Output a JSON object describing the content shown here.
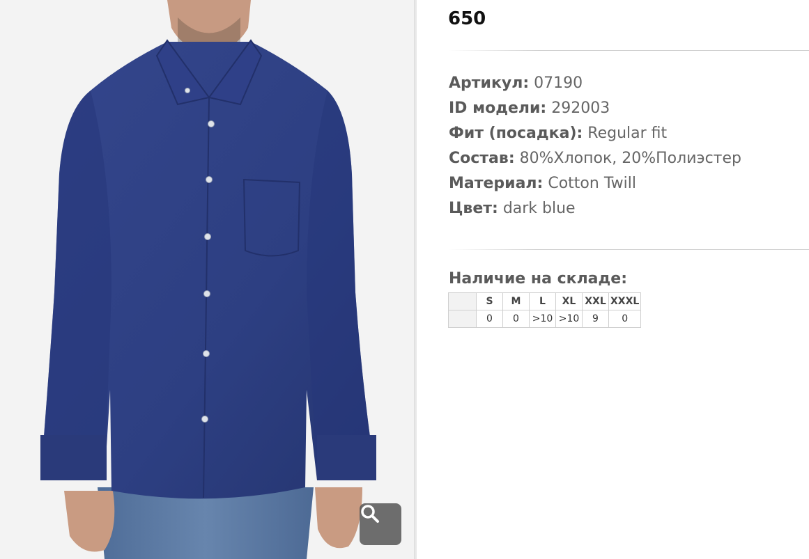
{
  "product": {
    "price": "650",
    "image_alt": "dark blue shirt",
    "zoom_icon": "search-icon"
  },
  "specs": [
    {
      "label": "Артикул:",
      "value": "07190"
    },
    {
      "label": "ID модели:",
      "value": "292003"
    },
    {
      "label": "Фит (посадка):",
      "value": "Regular fit"
    },
    {
      "label": "Состав:",
      "value": "80%Хлопок, 20%Полиэстер"
    },
    {
      "label": "Материал:",
      "value": "Cotton Twill"
    },
    {
      "label": "Цвет:",
      "value": "dark blue"
    }
  ],
  "stock": {
    "title": "Наличие на складе:",
    "sizes": [
      "S",
      "M",
      "L",
      "XL",
      "XXL",
      "XXXL"
    ],
    "quantities": [
      "0",
      "0",
      ">10",
      ">10",
      "9",
      "0"
    ]
  },
  "colors": {
    "shirt": "#2e3f80",
    "shirt_dark": "#23316a",
    "jeans": "#5b7aa4",
    "skin": "#c99b82"
  }
}
